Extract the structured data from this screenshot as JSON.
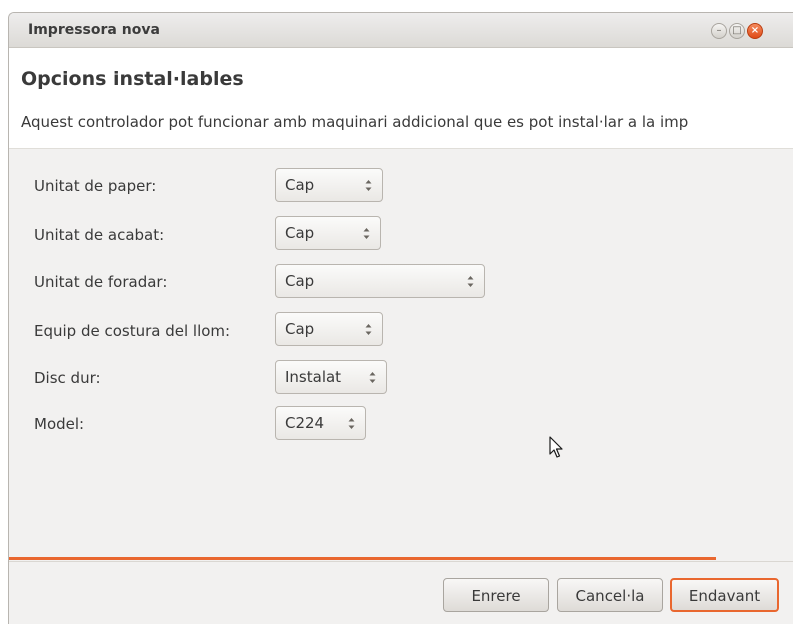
{
  "window": {
    "title": "Impressora nova",
    "controls": {
      "minimize": "–",
      "maximize": "□",
      "close": "×"
    }
  },
  "page": {
    "heading": "Opcions instal·lables",
    "description": "Aquest controlador pot funcionar amb maquinari addicional que es pot instal·lar a la imp"
  },
  "options": [
    {
      "label": "Unitat de paper:",
      "value": "Cap"
    },
    {
      "label": "Unitat de acabat:",
      "value": "Cap"
    },
    {
      "label": "Unitat de foradar:",
      "value": "Cap"
    },
    {
      "label": "Equip de costura del llom:",
      "value": "Cap"
    },
    {
      "label": "Disc dur:",
      "value": "Instalat"
    },
    {
      "label": "Model:",
      "value": "C224"
    }
  ],
  "buttons": {
    "back": "Enrere",
    "cancel": "Cancel·la",
    "forward": "Endavant"
  },
  "colors": {
    "accent": "#e9672f",
    "close_button": "#df4a16"
  },
  "icons": {
    "combo_arrows": "up-down-arrows-icon",
    "cursor": "mouse-pointer-icon"
  }
}
